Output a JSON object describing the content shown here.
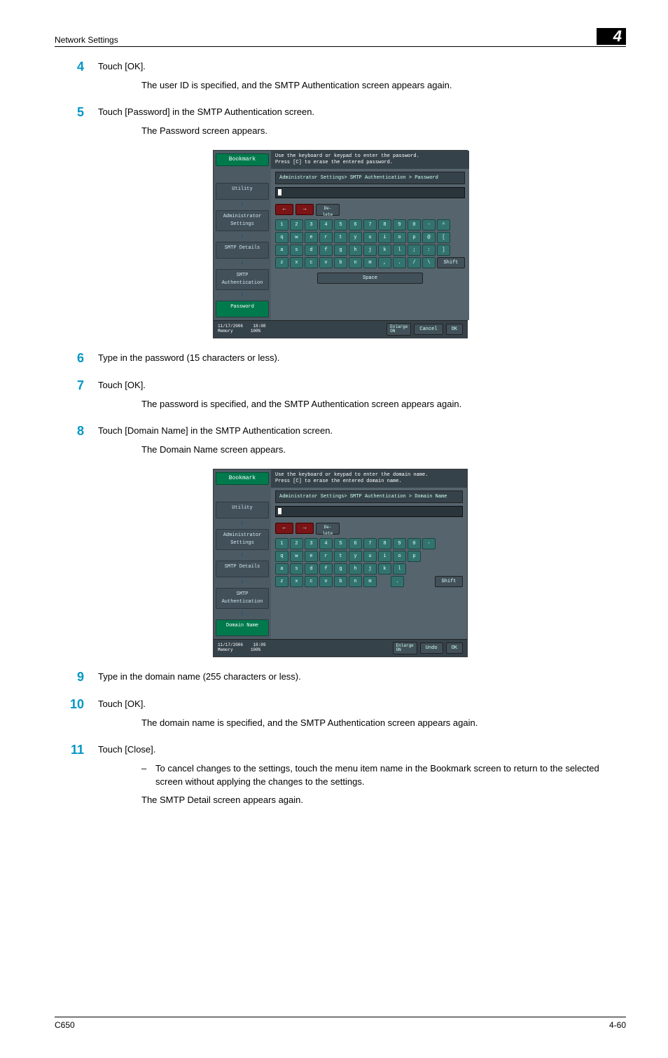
{
  "header": {
    "section": "Network Settings",
    "chapter": "4"
  },
  "steps": {
    "4": {
      "line1": "Touch [OK].",
      "line2": "The user ID is specified, and the SMTP Authentication screen appears again."
    },
    "5": {
      "line1": "Touch [Password] in the SMTP Authentication screen.",
      "line2": "The Password screen appears."
    },
    "6": {
      "line1": "Type in the password (15 characters or less)."
    },
    "7": {
      "line1": "Touch [OK].",
      "line2": "The password is specified, and the SMTP Authentication screen appears again."
    },
    "8": {
      "line1": "Touch [Domain Name] in the SMTP Authentication screen.",
      "line2": "The Domain Name screen appears."
    },
    "9": {
      "line1": "Type in the domain name (255 characters or less)."
    },
    "10": {
      "line1": "Touch [OK].",
      "line2": "The domain name is specified, and the SMTP Authentication screen appears again."
    },
    "11": {
      "line1": "Touch [Close].",
      "bullet": "To cancel changes to the settings, touch the menu item name in the Bookmark screen to return to the selected screen without applying the changes to the settings.",
      "line2": "The SMTP Detail screen appears again."
    }
  },
  "screen_password": {
    "instr1": "Use the keyboard or keypad to enter the password.",
    "instr2": "Press [C] to erase the entered password.",
    "bookmark": "Bookmark",
    "nav": {
      "utility": "Utility",
      "admin": "Administrator\nSettings",
      "smtp_details": "SMTP Details",
      "smtp_auth": "SMTP\nAuthentication",
      "password": "Password"
    },
    "breadcrumb": "Administrator Settings> SMTP Authentication > Password",
    "delete": "De-\nlete",
    "row1": [
      "1",
      "2",
      "3",
      "4",
      "5",
      "6",
      "7",
      "8",
      "9",
      "0",
      "-",
      "^"
    ],
    "row2": [
      "q",
      "w",
      "e",
      "r",
      "t",
      "y",
      "u",
      "i",
      "o",
      "p",
      "@",
      "["
    ],
    "row3": [
      "a",
      "s",
      "d",
      "f",
      "g",
      "h",
      "j",
      "k",
      "l",
      ";",
      ":",
      "]"
    ],
    "row4": [
      "z",
      "x",
      "c",
      "v",
      "b",
      "n",
      "m",
      ",",
      ".",
      "/",
      "\\"
    ],
    "shift": "Shift",
    "space": "Space",
    "footer": {
      "date": "11/17/2006",
      "time": "18:08",
      "memory": "Memory",
      "memval": "100%",
      "enlarge": "Enlarge\nON",
      "cancel": "Cancel",
      "ok": "OK"
    }
  },
  "screen_domain": {
    "instr1": "Use the keyboard or keypad to enter the domain name.",
    "instr2": "Press [C] to erase the entered domain name.",
    "bookmark": "Bookmark",
    "nav": {
      "utility": "Utility",
      "admin": "Administrator\nSettings",
      "smtp_details": "SMTP Details",
      "smtp_auth": "SMTP\nAuthentication",
      "domain": "Domain Name"
    },
    "breadcrumb": "Administrator Settings> SMTP Authentication > Domain Name",
    "delete": "De-\nlete",
    "row1": [
      "1",
      "2",
      "3",
      "4",
      "5",
      "6",
      "7",
      "8",
      "9",
      "0",
      "-"
    ],
    "row2": [
      "q",
      "w",
      "e",
      "r",
      "t",
      "y",
      "u",
      "i",
      "o",
      "p"
    ],
    "row3": [
      "a",
      "s",
      "d",
      "f",
      "g",
      "h",
      "j",
      "k",
      "l"
    ],
    "row4": [
      "z",
      "x",
      "c",
      "v",
      "b",
      "n",
      "m"
    ],
    "dot": ".",
    "shift": "Shift",
    "footer": {
      "date": "11/17/2006",
      "time": "18:09",
      "memory": "Memory",
      "memval": "100%",
      "enlarge": "Enlarge\nON",
      "undo": "Undo",
      "ok": "OK"
    }
  },
  "footer": {
    "model": "C650",
    "page": "4-60"
  }
}
